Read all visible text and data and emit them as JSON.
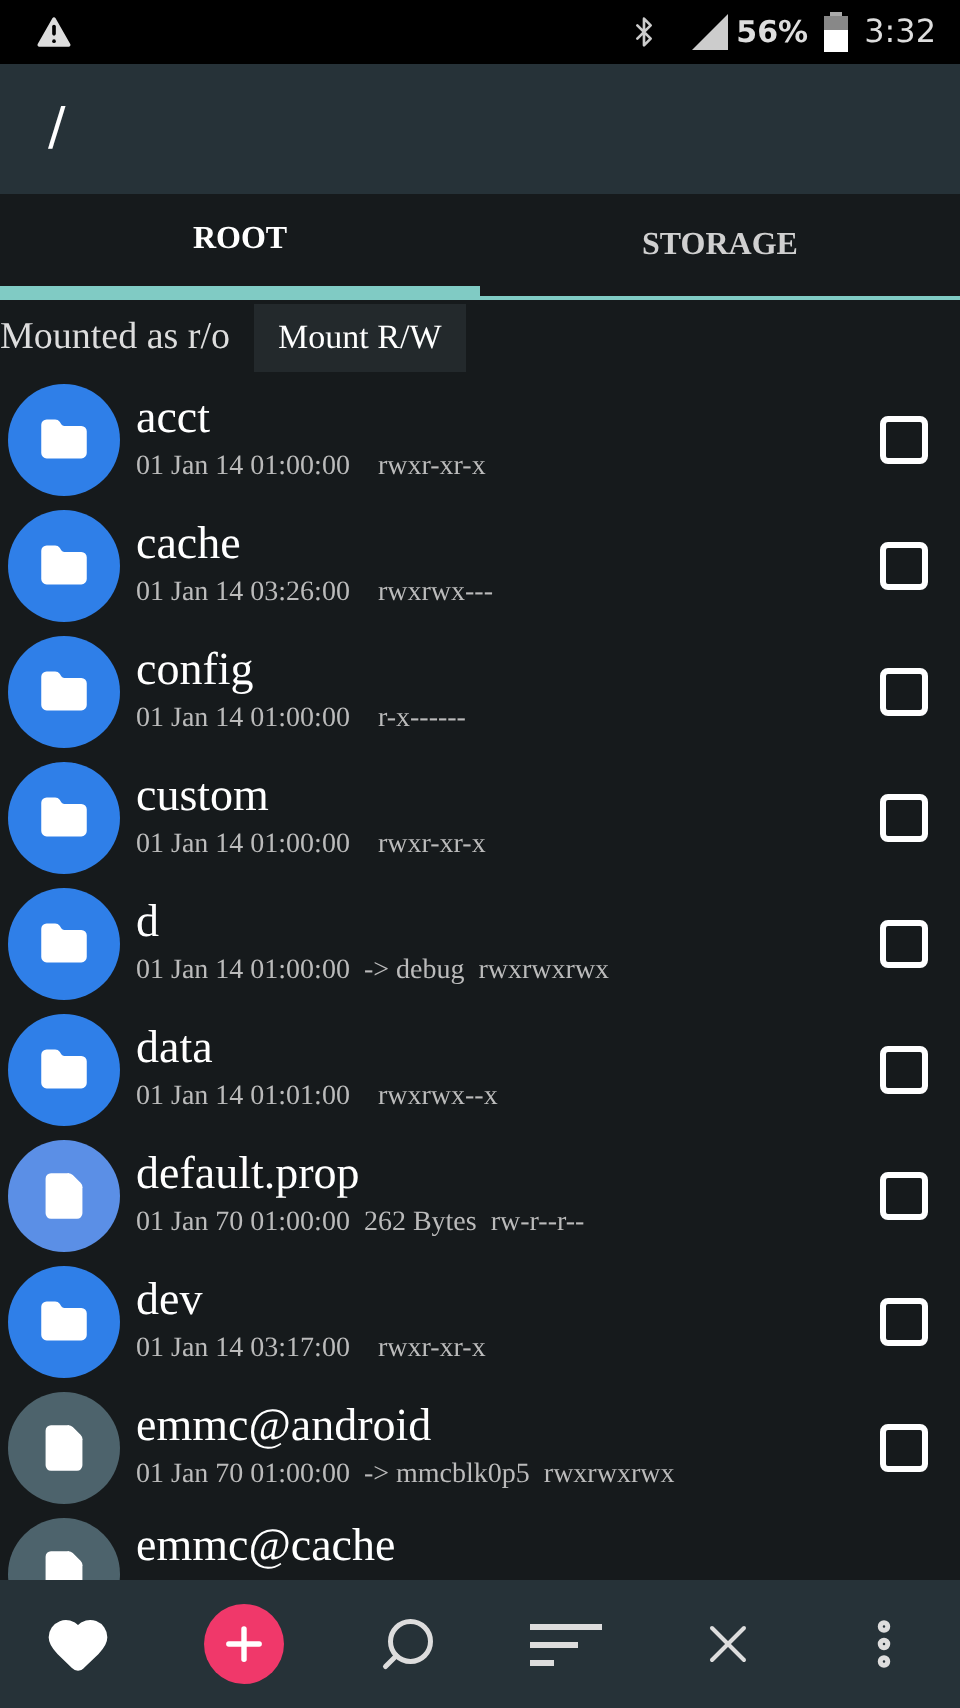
{
  "status_bar": {
    "battery": "56%",
    "time": "3:32"
  },
  "header": {
    "path": "/"
  },
  "tabs": [
    {
      "label": "ROOT",
      "selected": true
    },
    {
      "label": "STORAGE",
      "selected": false
    }
  ],
  "mount": {
    "status": "Mounted as r/o",
    "button": "Mount R/W"
  },
  "files": [
    {
      "kind": "folder",
      "name": "acct",
      "date": "01 Jan 14 01:00:00",
      "perms": "rwxr-xr-x",
      "checked": false
    },
    {
      "kind": "folder",
      "name": "cache",
      "date": "01 Jan 14 03:26:00",
      "perms": "rwxrwx---",
      "checked": false
    },
    {
      "kind": "folder",
      "name": "config",
      "date": "01 Jan 14 01:00:00",
      "perms": "r-x------",
      "checked": false
    },
    {
      "kind": "folder",
      "name": "custom",
      "date": "01 Jan 14 01:00:00",
      "perms": "rwxr-xr-x",
      "checked": false
    },
    {
      "kind": "folder",
      "name": "d",
      "date": "01 Jan 14 01:00:00",
      "info": "-> debug",
      "perms": "rwxrwxrwx",
      "checked": false
    },
    {
      "kind": "folder",
      "name": "data",
      "date": "01 Jan 14 01:01:00",
      "perms": "rwxrwx--x",
      "checked": false
    },
    {
      "kind": "document",
      "name": "default.prop",
      "date": "01 Jan 70 01:00:00",
      "info": "262 Bytes",
      "perms": "rw-r--r--",
      "checked": false
    },
    {
      "kind": "folder",
      "name": "dev",
      "date": "01 Jan 14 03:17:00",
      "perms": "rwxr-xr-x",
      "checked": false
    },
    {
      "kind": "file",
      "name": "emmc@android",
      "date": "01 Jan 70 01:00:00",
      "info": "-> mmcblk0p5",
      "perms": "rwxrwxrwx",
      "checked": false
    },
    {
      "kind": "file",
      "name": "emmc@cache"
    }
  ]
}
